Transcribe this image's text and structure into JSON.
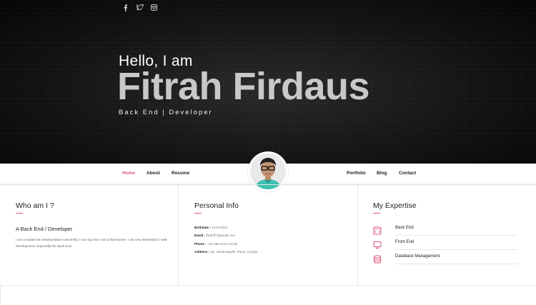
{
  "social": [
    {
      "icon": "facebook-icon",
      "glyph": "f"
    },
    {
      "icon": "twitter-icon",
      "glyph": "t"
    },
    {
      "icon": "instagram-icon",
      "glyph": ""
    }
  ],
  "hero": {
    "greeting": "Hello, I am",
    "name": "Fitrah Firdaus",
    "role": "Back End | Developer"
  },
  "nav": {
    "home": "Home",
    "about": "About",
    "resume": "Resume",
    "portfolio": "Portfolio",
    "blog": "Blog",
    "contact": "Contact"
  },
  "about": {
    "title": "Who am I ?",
    "subtitle": "A Back End / Developer",
    "description": "I am a student at Sebelas Maret University. I can say that I am a fast learner. I am very interested in web development, especially the Back End."
  },
  "info": {
    "title": "Personal Info",
    "birthdate_label": "Birthdate :",
    "birthdate": " 11/11/2001",
    "email_label": "Email :",
    "email": " fitrahff7@gmail.com",
    "phone_label": "Phone :",
    "phone": " +62 895 4114 23735",
    "address_label": "Address :",
    "address": " Kp. Sukamagalih, Pacet, Cianjur."
  },
  "expertise": {
    "title": "My Expertise",
    "items": [
      "Back End",
      "Front End",
      "Database Management"
    ]
  },
  "colors": {
    "accent": "#e0567a"
  }
}
